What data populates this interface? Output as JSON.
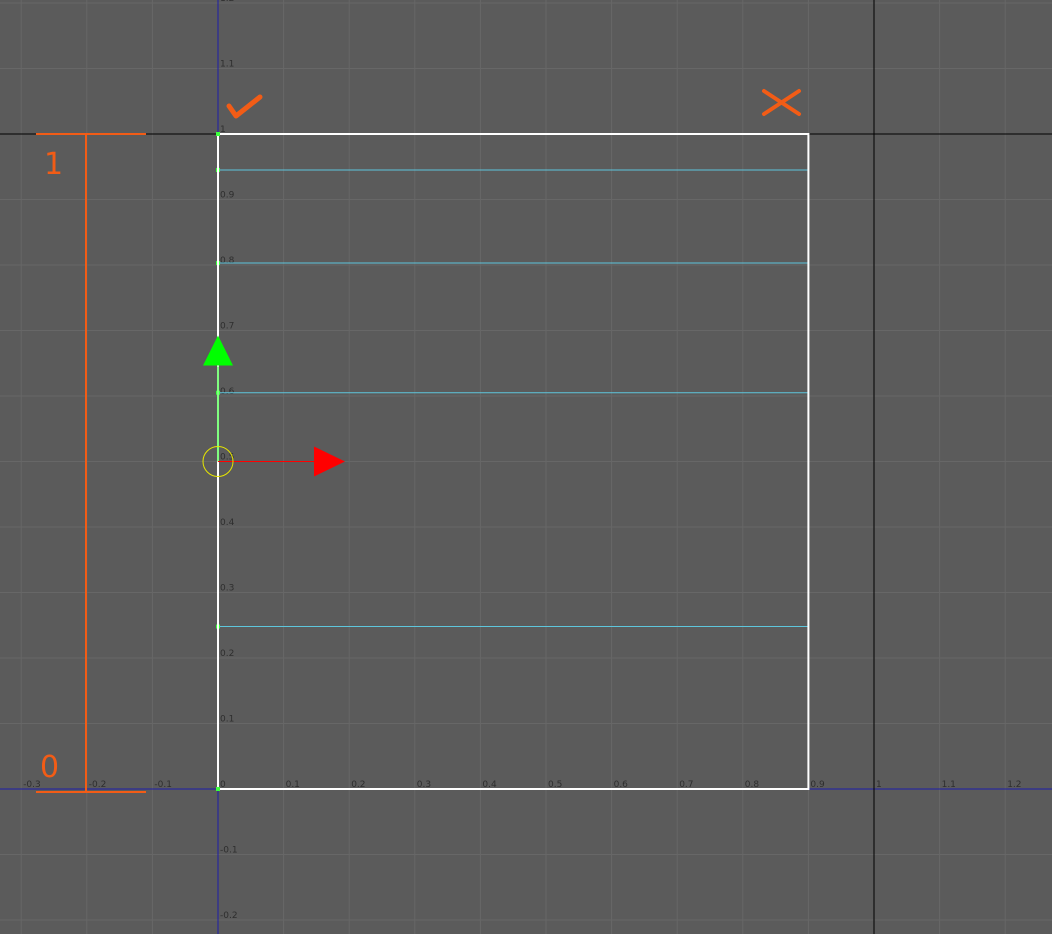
{
  "editor": {
    "colors": {
      "background": "#5b5b5b",
      "grid_line": "#676767",
      "axis_line": "#1e1ea8",
      "unit_line": "#000000",
      "boundary": "#ffffff",
      "slice_line": "#5ec6dc",
      "slice_point": "#3cff3c",
      "accent": "#f25c16",
      "gizmo_x": "#ff0000",
      "gizmo_y": "#00ff00",
      "pivot": "#e6e600"
    },
    "x_tick_labels": [
      "-0.3",
      "-0.2",
      "-0.1",
      "0",
      "0.1",
      "0.2",
      "0.3",
      "0.4",
      "0.5",
      "0.6",
      "0.7",
      "0.8",
      "0.9",
      "1",
      "1.1",
      "1.2"
    ],
    "y_tick_labels": [
      "1.2",
      "1.1",
      "1",
      "0.9",
      "0.8",
      "0.7",
      "0.6",
      "0.5",
      "0.4",
      "0.3",
      "0.2",
      "0.1",
      "-0.1",
      "-0.2"
    ],
    "boundary": {
      "x_min": 0,
      "x_max": 0.9,
      "y_min": 0,
      "y_max": 1
    },
    "slices": [
      0.945,
      0.803,
      0.605,
      0.248
    ],
    "pivot": {
      "x": 0,
      "y": 0.5
    },
    "range_indicator": {
      "top_label": "1",
      "bottom_label": "0"
    },
    "actions": {
      "confirm_icon": "check-icon",
      "cancel_icon": "close-icon"
    }
  }
}
